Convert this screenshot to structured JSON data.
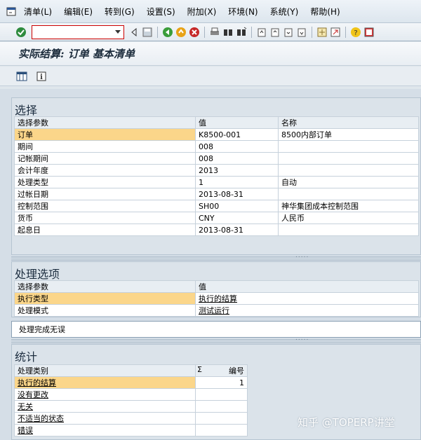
{
  "menu": {
    "items": [
      "清单(L)",
      "编辑(E)",
      "转到(G)",
      "设置(S)",
      "附加(X)",
      "环境(N)",
      "系统(Y)",
      "帮助(H)"
    ]
  },
  "toolbar": {
    "command_field_value": ""
  },
  "title": "实际结算: 订单 基本清单",
  "selection": {
    "heading": "选择",
    "columns": [
      "选择参数",
      "值",
      "名称"
    ],
    "rows": [
      {
        "param": "订单",
        "value": "K8500-001",
        "name": "8500内部订单"
      },
      {
        "param": "期间",
        "value": "008",
        "name": ""
      },
      {
        "param": "记帐期间",
        "value": "008",
        "name": ""
      },
      {
        "param": "会计年度",
        "value": "2013",
        "name": ""
      },
      {
        "param": "处理类型",
        "value": "1",
        "name": "自动"
      },
      {
        "param": "过帐日期",
        "value": "2013-08-31",
        "name": ""
      },
      {
        "param": "控制范围",
        "value": "SH00",
        "name": "神华集团成本控制范围"
      },
      {
        "param": "货币",
        "value": "CNY",
        "name": "人民币"
      },
      {
        "param": "起息日",
        "value": "2013-08-31",
        "name": ""
      }
    ]
  },
  "options": {
    "heading": "处理选项",
    "columns": [
      "选择参数",
      "值"
    ],
    "rows": [
      {
        "param": "执行类型",
        "value": "执行的结算"
      },
      {
        "param": "处理模式",
        "value": "测试运行"
      }
    ]
  },
  "message": "处理完成无误",
  "stats": {
    "heading": "统计",
    "columns": [
      "处理类别",
      "Σ",
      "编号"
    ],
    "rows": [
      {
        "category": "执行的结算",
        "count": "1"
      },
      {
        "category": "没有更改",
        "count": ""
      },
      {
        "category": "无关",
        "count": ""
      },
      {
        "category": "不适当的状态",
        "count": ""
      },
      {
        "category": "错误",
        "count": ""
      }
    ]
  },
  "watermark": "知乎 @TOPERP讲堂"
}
